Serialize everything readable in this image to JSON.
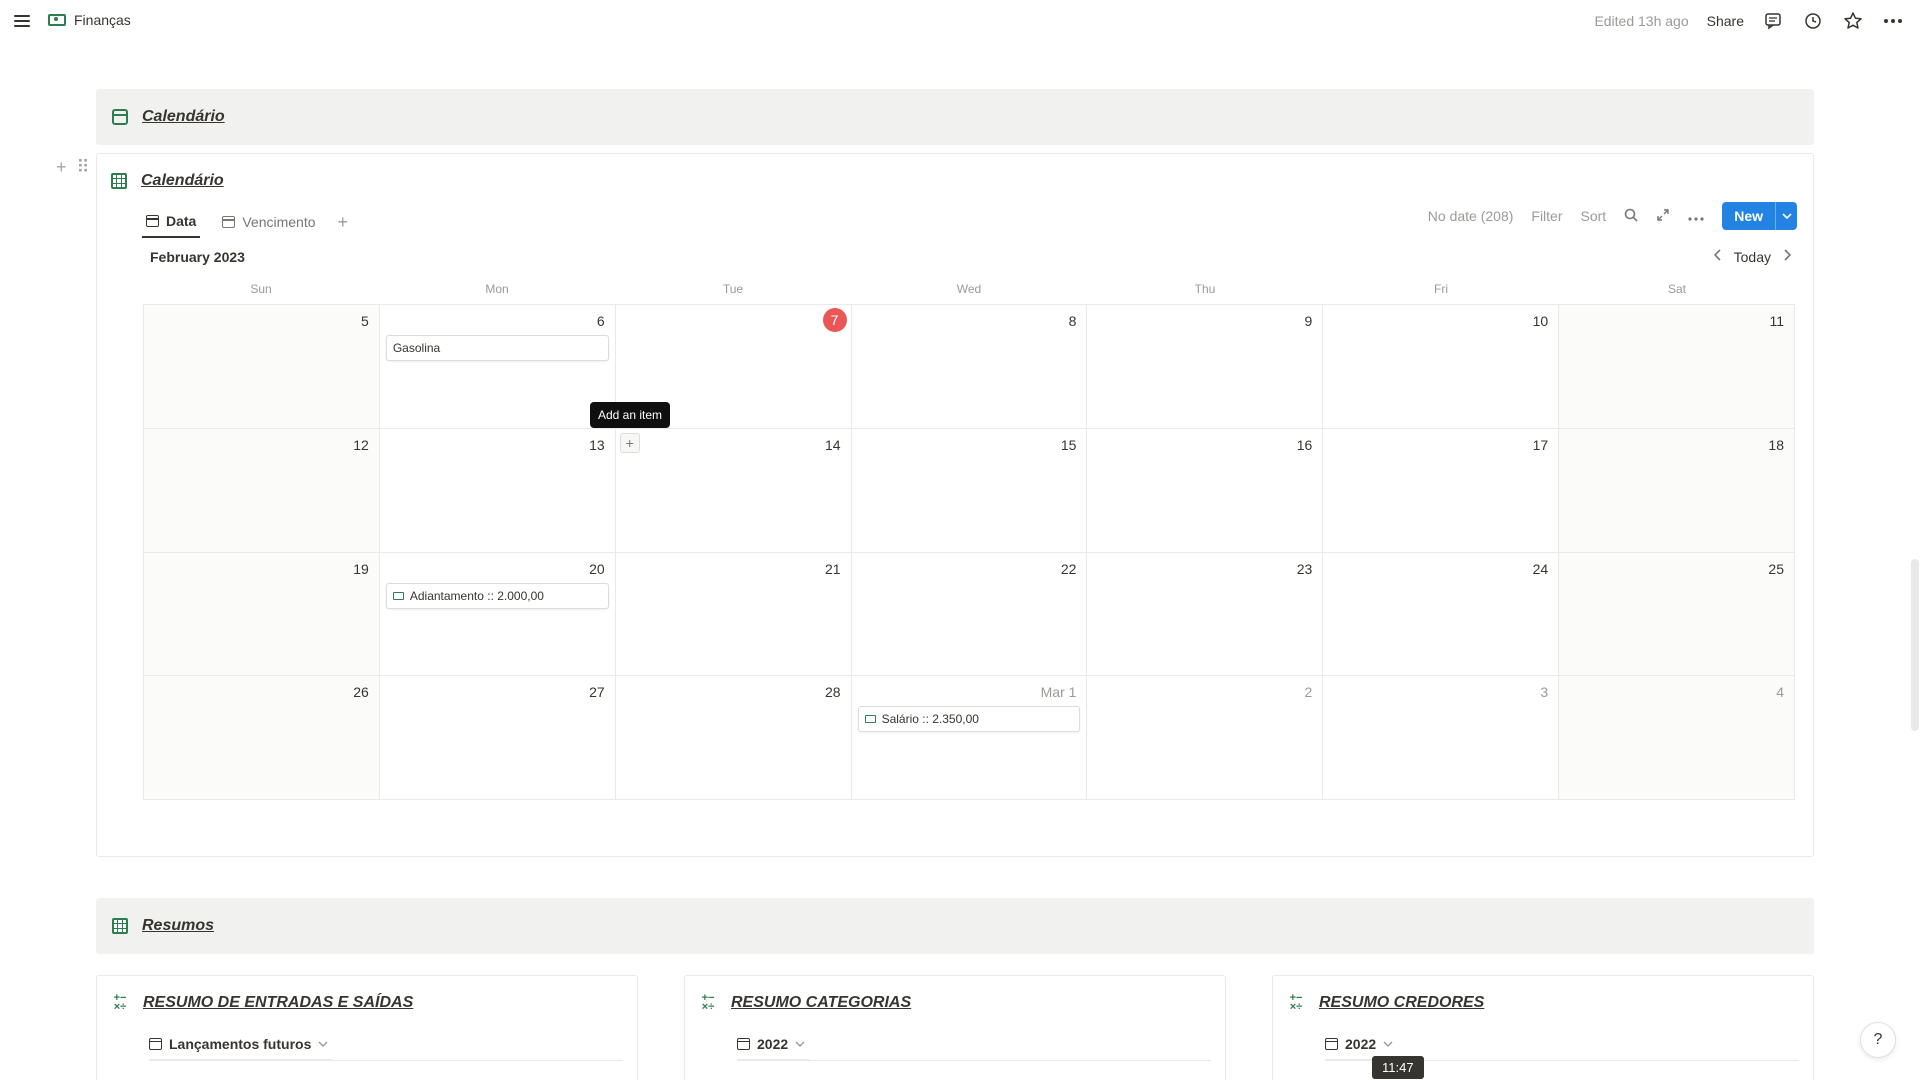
{
  "topbar": {
    "breadcrumb": "Finanças",
    "edited": "Edited 13h ago",
    "share": "Share"
  },
  "sections": {
    "calendario": "Calendário",
    "resumos": "Resumos"
  },
  "calendar": {
    "title": "Calendário",
    "tabs": [
      {
        "label": "Data",
        "active": true
      },
      {
        "label": "Vencimento",
        "active": false
      }
    ],
    "toolbar": {
      "no_date": "No date (208)",
      "filter": "Filter",
      "sort": "Sort",
      "new": "New"
    },
    "month": "February 2023",
    "today_btn": "Today",
    "weekdays": [
      "Sun",
      "Mon",
      "Tue",
      "Wed",
      "Thu",
      "Fri",
      "Sat"
    ],
    "days": [
      {
        "n": "5"
      },
      {
        "n": "6",
        "event": "Gasolina"
      },
      {
        "n": "7",
        "today": true
      },
      {
        "n": "8"
      },
      {
        "n": "9"
      },
      {
        "n": "10"
      },
      {
        "n": "11"
      },
      {
        "n": "12"
      },
      {
        "n": "13"
      },
      {
        "n": "14",
        "add": true
      },
      {
        "n": "15"
      },
      {
        "n": "16"
      },
      {
        "n": "17"
      },
      {
        "n": "18"
      },
      {
        "n": "19"
      },
      {
        "n": "20",
        "event": "Adiantamento :: 2.000,00",
        "icon": true
      },
      {
        "n": "21"
      },
      {
        "n": "22"
      },
      {
        "n": "23"
      },
      {
        "n": "24"
      },
      {
        "n": "25"
      },
      {
        "n": "26"
      },
      {
        "n": "27"
      },
      {
        "n": "28"
      },
      {
        "n": "Mar 1",
        "other": true,
        "event": "Salário :: 2.350,00",
        "icon": true
      },
      {
        "n": "2",
        "other": true
      },
      {
        "n": "3",
        "other": true
      },
      {
        "n": "4",
        "other": true
      }
    ],
    "tooltip": "Add an item"
  },
  "cards": [
    {
      "title": "RESUMO DE ENTRADAS E SAÍDAS",
      "view": "Lançamentos futuros"
    },
    {
      "title": "RESUMO CATEGORIAS",
      "view": "2022"
    },
    {
      "title": "RESUMO CREDORES",
      "view": "2022"
    }
  ],
  "time_badge": "11:47",
  "help": "?",
  "colors": {
    "accent": "#2383e2",
    "today": "#eb5757",
    "icon_green": "#2e7d4f"
  }
}
